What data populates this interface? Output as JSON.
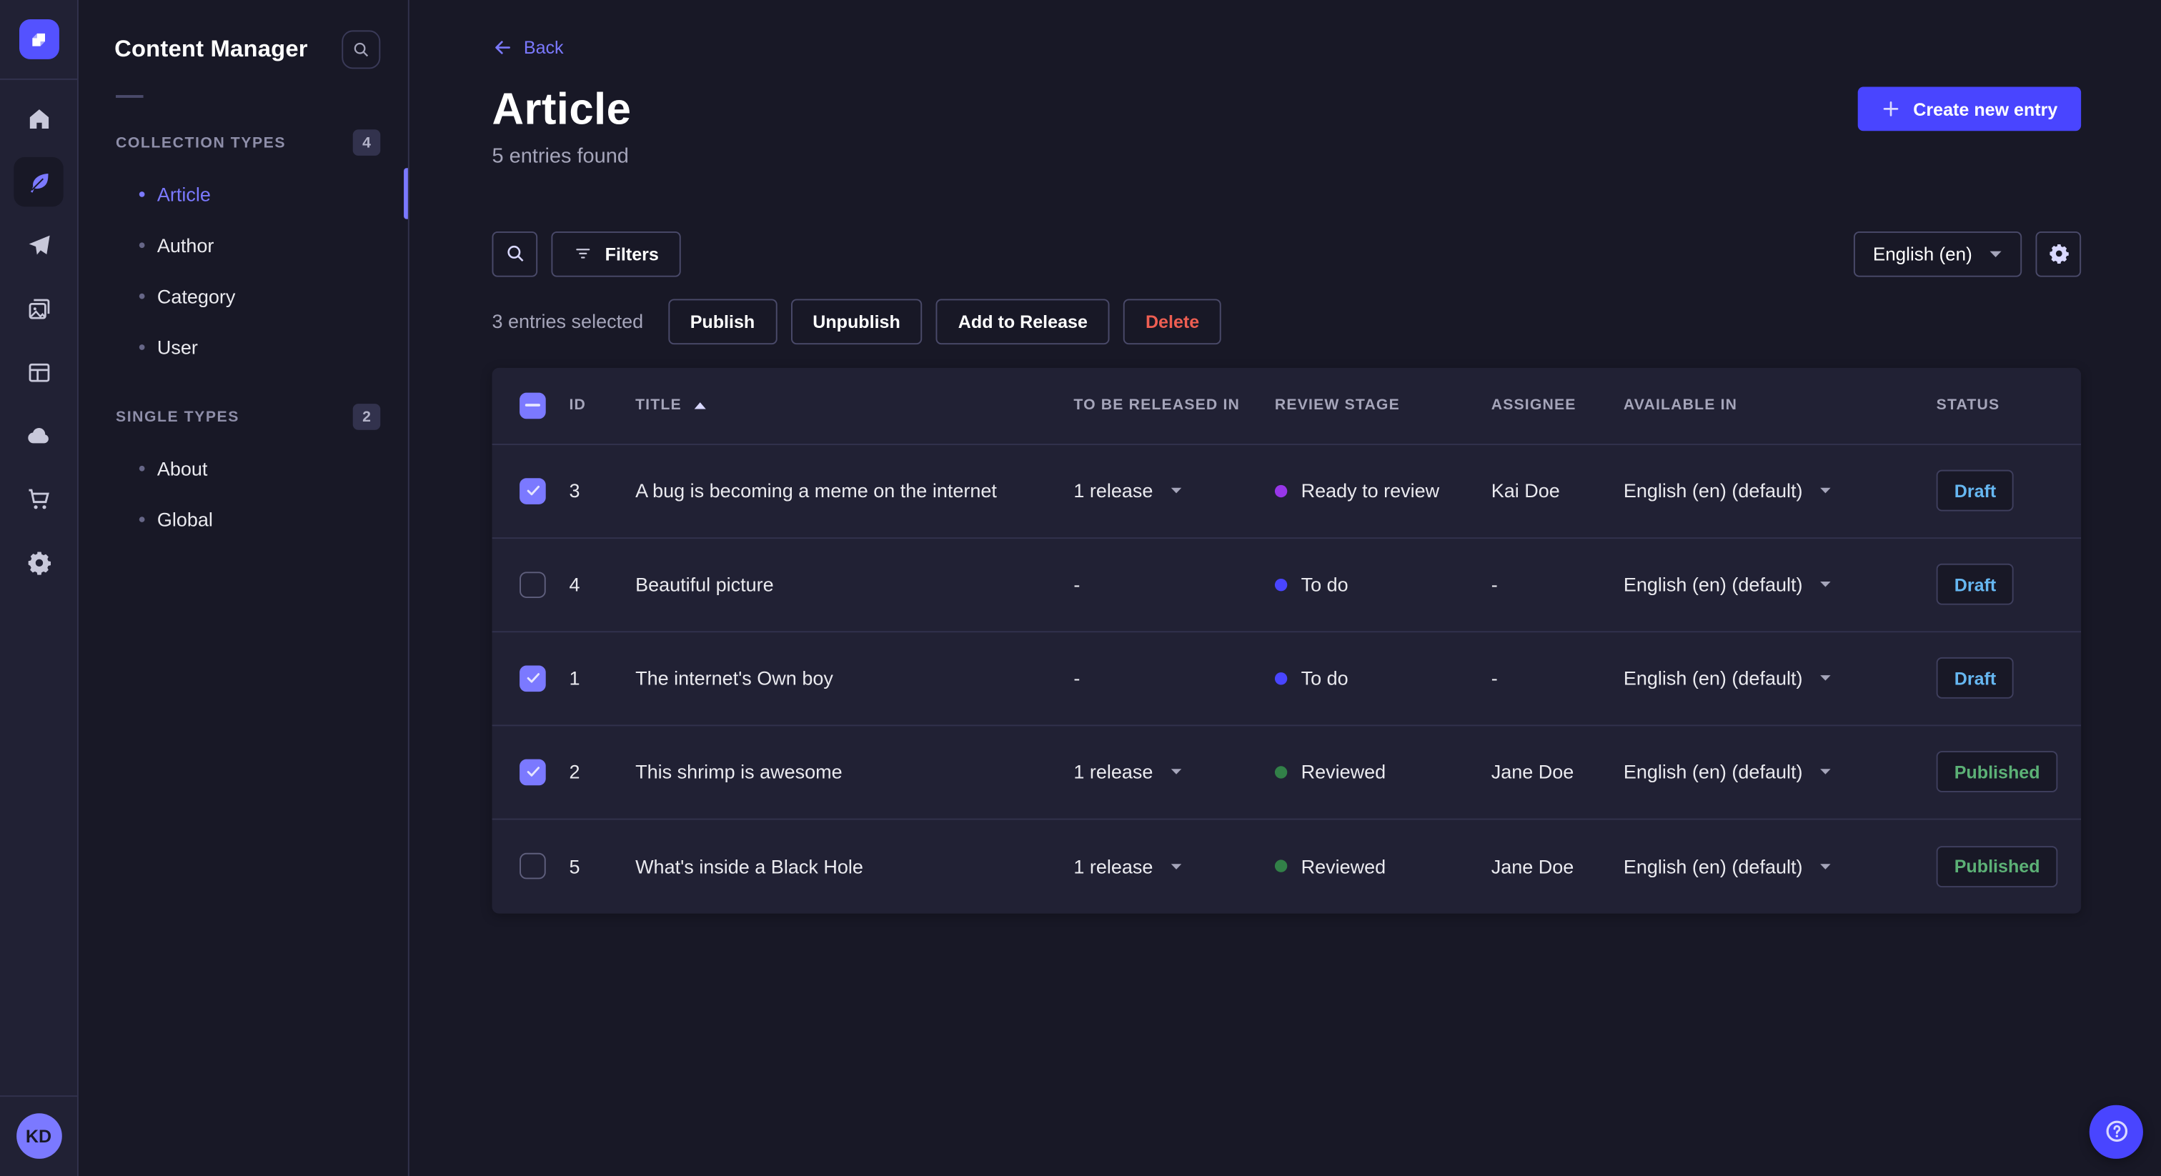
{
  "colors": {
    "accent": "#4945ff",
    "accent_light": "#7b79ff",
    "logo_bg": "#5452ff",
    "danger": "#ee5e52",
    "draft_text": "#66b7f1",
    "published_text": "#5cb176"
  },
  "icons": [
    "strapi-logo",
    "home",
    "feather",
    "paper-plane",
    "media",
    "layout",
    "cloud",
    "cart",
    "gear",
    "search",
    "filter",
    "plus",
    "back-arrow",
    "caret-down",
    "sort-asc-arrow",
    "check",
    "indeterminate-dash",
    "help"
  ],
  "user": {
    "initials": "KD"
  },
  "subnav": {
    "title": "Content Manager",
    "sections": [
      {
        "label": "COLLECTION TYPES",
        "badge": "4",
        "items": [
          {
            "label": "Article",
            "active": true
          },
          {
            "label": "Author",
            "active": false
          },
          {
            "label": "Category",
            "active": false
          },
          {
            "label": "User",
            "active": false
          }
        ]
      },
      {
        "label": "SINGLE TYPES",
        "badge": "2",
        "items": [
          {
            "label": "About",
            "active": false
          },
          {
            "label": "Global",
            "active": false
          }
        ]
      }
    ]
  },
  "header": {
    "back_label": "Back",
    "title": "Article",
    "subtitle": "5 entries found",
    "create_label": "Create new entry"
  },
  "toolbar": {
    "filters_label": "Filters",
    "locale_value": "English (en)"
  },
  "selection": {
    "count_text": "3 entries selected",
    "publish": "Publish",
    "unpublish": "Unpublish",
    "add_to_release": "Add to Release",
    "delete": "Delete"
  },
  "table": {
    "columns": [
      "ID",
      "TITLE",
      "TO BE RELEASED IN",
      "REVIEW STAGE",
      "ASSIGNEE",
      "AVAILABLE IN",
      "STATUS"
    ],
    "sort": {
      "column": "TITLE",
      "ascending": true
    },
    "header_checkbox_state": "indeterminate",
    "rows": [
      {
        "checked": true,
        "id": "3",
        "title": "A bug is becoming a meme on the internet",
        "to_be_released_in": "1 release",
        "review_stage": "Ready to review",
        "stage_color": "#9736E8",
        "assignee": "Kai Doe",
        "available_in": "English (en) (default)",
        "status": "Draft"
      },
      {
        "checked": false,
        "id": "4",
        "title": "Beautiful picture",
        "to_be_released_in": "-",
        "review_stage": "To do",
        "stage_color": "#4945FF",
        "assignee": "-",
        "available_in": "English (en) (default)",
        "status": "Draft"
      },
      {
        "checked": true,
        "id": "1",
        "title": "The internet's Own boy",
        "to_be_released_in": "-",
        "review_stage": "To do",
        "stage_color": "#4945FF",
        "assignee": "-",
        "available_in": "English (en) (default)",
        "status": "Draft"
      },
      {
        "checked": true,
        "id": "2",
        "title": "This shrimp is awesome",
        "to_be_released_in": "1 release",
        "review_stage": "Reviewed",
        "stage_color": "#328048",
        "assignee": "Jane Doe",
        "available_in": "English (en) (default)",
        "status": "Published"
      },
      {
        "checked": false,
        "id": "5",
        "title": "What's inside a Black Hole",
        "to_be_released_in": "1 release",
        "review_stage": "Reviewed",
        "stage_color": "#328048",
        "assignee": "Jane Doe",
        "available_in": "English (en) (default)",
        "status": "Published"
      }
    ]
  }
}
